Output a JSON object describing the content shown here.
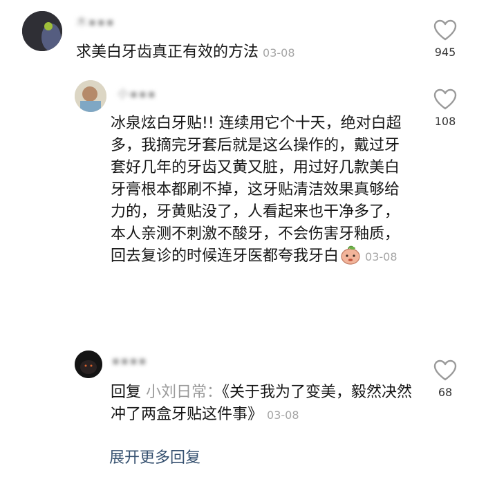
{
  "comments": [
    {
      "username": "木▪▪▪",
      "text": "求美白牙齿真正有效的方法",
      "date": "03-08",
      "likes": "945"
    },
    {
      "username": "小▪▪▪",
      "text": "冰泉炫白牙贴!! 连续用它个十天，绝对白超多，我摘完牙套后就是这么操作的，戴过牙套好几年的牙齿又黄又脏，用过好几款美白牙膏根本都刷不掉，这牙贴清洁效果真够给力的，牙黄贴没了，人看起来也干净多了，本人亲测不刺激不酸牙，不会伤害牙釉质，回去复诊的时候连牙医都夸我牙白",
      "date": "03-08",
      "likes": "108"
    },
    {
      "username": "▪▪▪▪",
      "reply_label": "回复",
      "reply_to": "小刘日常：",
      "text": "《关于我为了变美，毅然决然冲了两盒牙贴这件事》",
      "date": "03-08",
      "likes": "68"
    }
  ],
  "more_replies": "展开更多回复",
  "icons": {
    "like": "heart-outline-icon",
    "emoji": "peach-face-emoji-icon"
  },
  "colors": {
    "text": "#161616",
    "meta": "#a5a5a5",
    "link": "#35506f",
    "icon": "#9a9a9a"
  }
}
